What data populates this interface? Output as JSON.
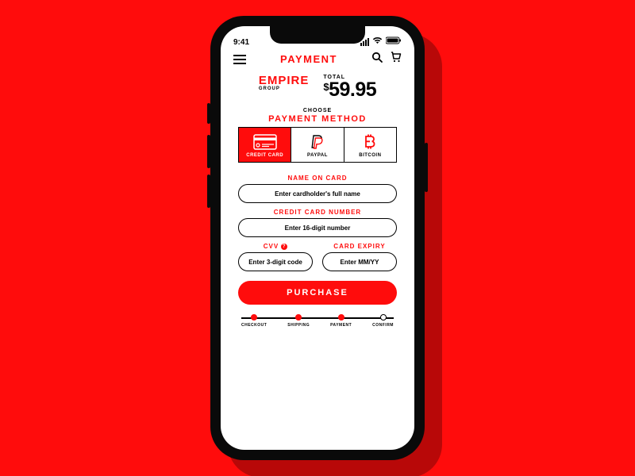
{
  "status": {
    "time": "9:41"
  },
  "header": {
    "title": "PAYMENT"
  },
  "brand": {
    "main": "EMPIRE",
    "sub": "GROUP"
  },
  "total": {
    "label": "TOTAL",
    "currency": "$",
    "amount": "59.95"
  },
  "method_section": {
    "choose": "CHOOSE",
    "heading": "PAYMENT METHOD"
  },
  "methods": {
    "card": "CREDIT CARD",
    "paypal": "PAYPAL",
    "bitcoin": "BITCOIN"
  },
  "fields": {
    "name": {
      "label": "NAME ON CARD",
      "placeholder": "Enter cardholder's full name"
    },
    "number": {
      "label": "CREDIT CARD NUMBER",
      "placeholder": "Enter 16-digit number"
    },
    "cvv": {
      "label": "CVV",
      "placeholder": "Enter 3-digit code"
    },
    "expiry": {
      "label": "CARD EXPIRY",
      "placeholder": "Enter MM/YY"
    }
  },
  "purchase": "PURCHASE",
  "steps": {
    "checkout": "CHECKOUT",
    "shipping": "SHIPPING",
    "payment": "PAYMENT",
    "confirm": "CONFIRM"
  }
}
